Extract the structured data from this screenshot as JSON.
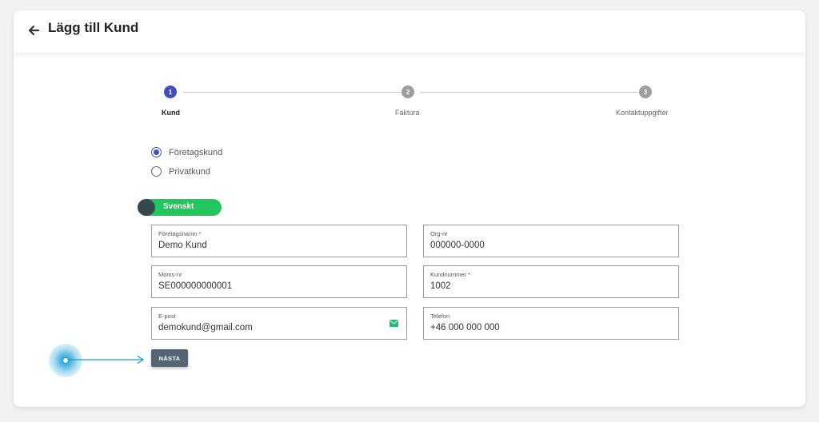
{
  "header": {
    "title": "Lägg till Kund",
    "back_icon": "arrow-left-icon"
  },
  "stepper": {
    "active_color": "#3f51b5",
    "inactive_color": "#9e9e9e",
    "steps": [
      {
        "number": "1",
        "label": "Kund",
        "active": true
      },
      {
        "number": "2",
        "label": "Faktura",
        "active": false
      },
      {
        "number": "3",
        "label": "Kontaktuppgifter",
        "active": false
      }
    ]
  },
  "customer_type": {
    "options": [
      {
        "label": "Företagskund",
        "checked": true
      },
      {
        "label": "Privatkund",
        "checked": false
      }
    ]
  },
  "language_toggle": {
    "label": "Svenskt",
    "on": true,
    "color": "#22c55e"
  },
  "fields": {
    "company_name": {
      "label": "Företagsnamn *",
      "value": "Demo Kund"
    },
    "org_nr": {
      "label": "Org-nr",
      "value": "000000-0000"
    },
    "vat_nr": {
      "label": "Moms-nr",
      "value": "SE000000000001"
    },
    "customer_number": {
      "label": "Kundnummer *",
      "value": "1002"
    },
    "email": {
      "label": "E-post",
      "value": "demokund@gmail.com",
      "icon": "mail-icon"
    },
    "phone": {
      "label": "Telefon",
      "value": "+46 000 000 000"
    }
  },
  "actions": {
    "next_label": "NÄSTA",
    "next_color": "#546474"
  },
  "click_indicator": {
    "color": "#18a0d7"
  }
}
